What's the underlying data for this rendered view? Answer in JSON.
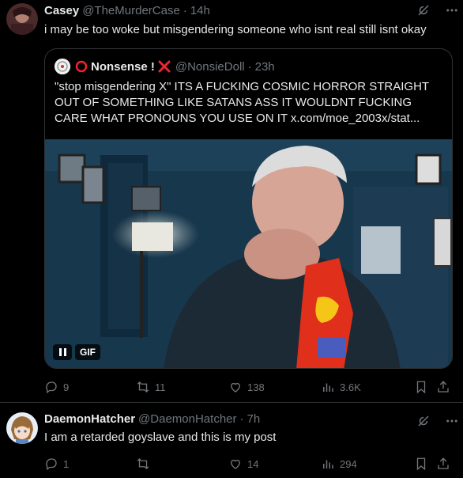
{
  "colors": {
    "bg": "#000000",
    "text": "#e7e9ea",
    "muted": "#71767b",
    "border": "#2f3336",
    "flag": "#f4212e"
  },
  "post1": {
    "name": "Casey",
    "handle": "@TheMurderCase",
    "sep": "·",
    "time": "14h",
    "text": "i may be too woke but misgendering someone who isnt real still isnt okay",
    "quote": {
      "name": "Nonsense !",
      "handle": "@NonsieDoll",
      "sep": "·",
      "time": "23h",
      "text": "\"stop misgendering X\" ITS A FUCKING COSMIC HORROR STRAIGHT OUT OF SOMETHING LIKE SATANS ASS IT WOULDNT FUCKING CARE WHAT PRONOUNS YOU USE ON IT  x.com/moe_2003x/stat...",
      "media_badge": "GIF"
    },
    "actions": {
      "replies": "9",
      "reposts": "11",
      "likes": "138",
      "views": "3.6K"
    }
  },
  "post2": {
    "name": "DaemonHatcher",
    "handle": "@DaemonHatcher",
    "sep": "·",
    "time": "7h",
    "text": "I am a retarded goyslave and this is my post",
    "actions": {
      "replies": "1",
      "reposts": "",
      "likes": "14",
      "views": "294"
    }
  },
  "icons": [
    "grok-icon",
    "more-icon",
    "reply-icon",
    "repost-icon",
    "like-icon",
    "views-icon",
    "bookmark-icon",
    "share-icon",
    "pause-icon",
    "red-circle-icon",
    "red-x-icon"
  ]
}
